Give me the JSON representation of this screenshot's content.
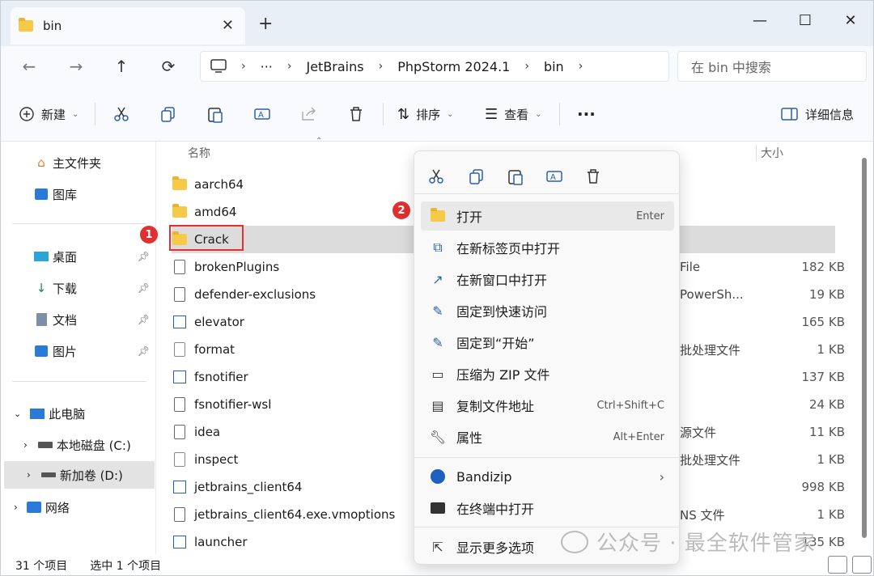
{
  "window": {
    "tab_title": "bin",
    "new_tab": "+",
    "minimize": "—",
    "maximize": "☐",
    "close": "✕",
    "tab_close": "✕"
  },
  "nav": {
    "back": "←",
    "forward": "→",
    "up": "↑",
    "refresh": "⟳"
  },
  "breadcrumb": {
    "more": "···",
    "items": [
      "JetBrains",
      "PhpStorm 2024.1",
      "bin"
    ]
  },
  "search": {
    "placeholder": "在 bin 中搜索"
  },
  "toolbar": {
    "new": "新建",
    "sort": "排序",
    "view": "查看",
    "more": "···",
    "details": "详细信息"
  },
  "sidebar": {
    "top": [
      {
        "label": "主文件夹",
        "icon": "home-icon"
      },
      {
        "label": "图库",
        "icon": "gallery-icon"
      }
    ],
    "quick": [
      {
        "label": "桌面",
        "icon": "desktop-icon"
      },
      {
        "label": "下载",
        "icon": "download-icon"
      },
      {
        "label": "文档",
        "icon": "documents-icon"
      },
      {
        "label": "图片",
        "icon": "pictures-icon"
      }
    ],
    "pc": {
      "label": "此电脑"
    },
    "drives": [
      {
        "label": "本地磁盘 (C:)"
      },
      {
        "label": "新加卷 (D:)"
      }
    ],
    "network": {
      "label": "网络"
    }
  },
  "columns": {
    "name": "名称",
    "size": "大小"
  },
  "files": [
    {
      "name": "aarch64",
      "kind": "folder",
      "type": "",
      "size": ""
    },
    {
      "name": "amd64",
      "kind": "folder",
      "type": "",
      "size": ""
    },
    {
      "name": "Crack",
      "kind": "folder",
      "type": "",
      "size": ""
    },
    {
      "name": "brokenPlugins",
      "kind": "file",
      "type": "File",
      "size": "182 KB"
    },
    {
      "name": "defender-exclusions",
      "kind": "script",
      "type": "PowerSh...",
      "size": "19 KB"
    },
    {
      "name": "elevator",
      "kind": "app",
      "type": "",
      "size": "165 KB"
    },
    {
      "name": "format",
      "kind": "batch",
      "type": "批处理文件",
      "size": "1 KB"
    },
    {
      "name": "fsnotifier",
      "kind": "app",
      "type": "",
      "size": "137 KB"
    },
    {
      "name": "fsnotifier-wsl",
      "kind": "file",
      "type": "",
      "size": "24 KB"
    },
    {
      "name": "idea",
      "kind": "file",
      "type": "源文件",
      "size": "11 KB"
    },
    {
      "name": "inspect",
      "kind": "batch",
      "type": "批处理文件",
      "size": "1 KB"
    },
    {
      "name": "jetbrains_client64",
      "kind": "app",
      "type": "",
      "size": "998 KB"
    },
    {
      "name": "jetbrains_client64.exe.vmoptions",
      "kind": "file",
      "type": "NS 文件",
      "size": "1 KB"
    },
    {
      "name": "launcher",
      "kind": "app",
      "type": "",
      "size": "135 KB"
    }
  ],
  "status": {
    "count": "31 个项目",
    "selected": "选中 1 个项目"
  },
  "annotations": {
    "badge1": "1",
    "badge2": "2"
  },
  "context_menu": {
    "items": [
      {
        "label": "打开",
        "shortcut": "Enter",
        "icon": "folder-icon"
      },
      {
        "label": "在新标签页中打开",
        "shortcut": "",
        "icon": "new-tab-icon"
      },
      {
        "label": "在新窗口中打开",
        "shortcut": "",
        "icon": "new-window-icon"
      },
      {
        "label": "固定到快速访问",
        "shortcut": "",
        "icon": "pin-icon"
      },
      {
        "label": "固定到“开始”",
        "shortcut": "",
        "icon": "pin-start-icon"
      },
      {
        "label": "压缩为 ZIP 文件",
        "shortcut": "",
        "icon": "zip-icon"
      },
      {
        "label": "复制文件地址",
        "shortcut": "Ctrl+Shift+C",
        "icon": "copy-path-icon"
      },
      {
        "label": "属性",
        "shortcut": "Alt+Enter",
        "icon": "wrench-icon"
      }
    ],
    "bandizip": "Bandizip",
    "terminal": "在终端中打开",
    "more": "显示更多选项",
    "submenu_arrow": "›"
  },
  "watermark": {
    "text": "公众号 · 最全软件管家"
  },
  "colors": {
    "accent": "#2a5fa8",
    "annotation": "#e0302f",
    "folder": "#f7c948"
  }
}
